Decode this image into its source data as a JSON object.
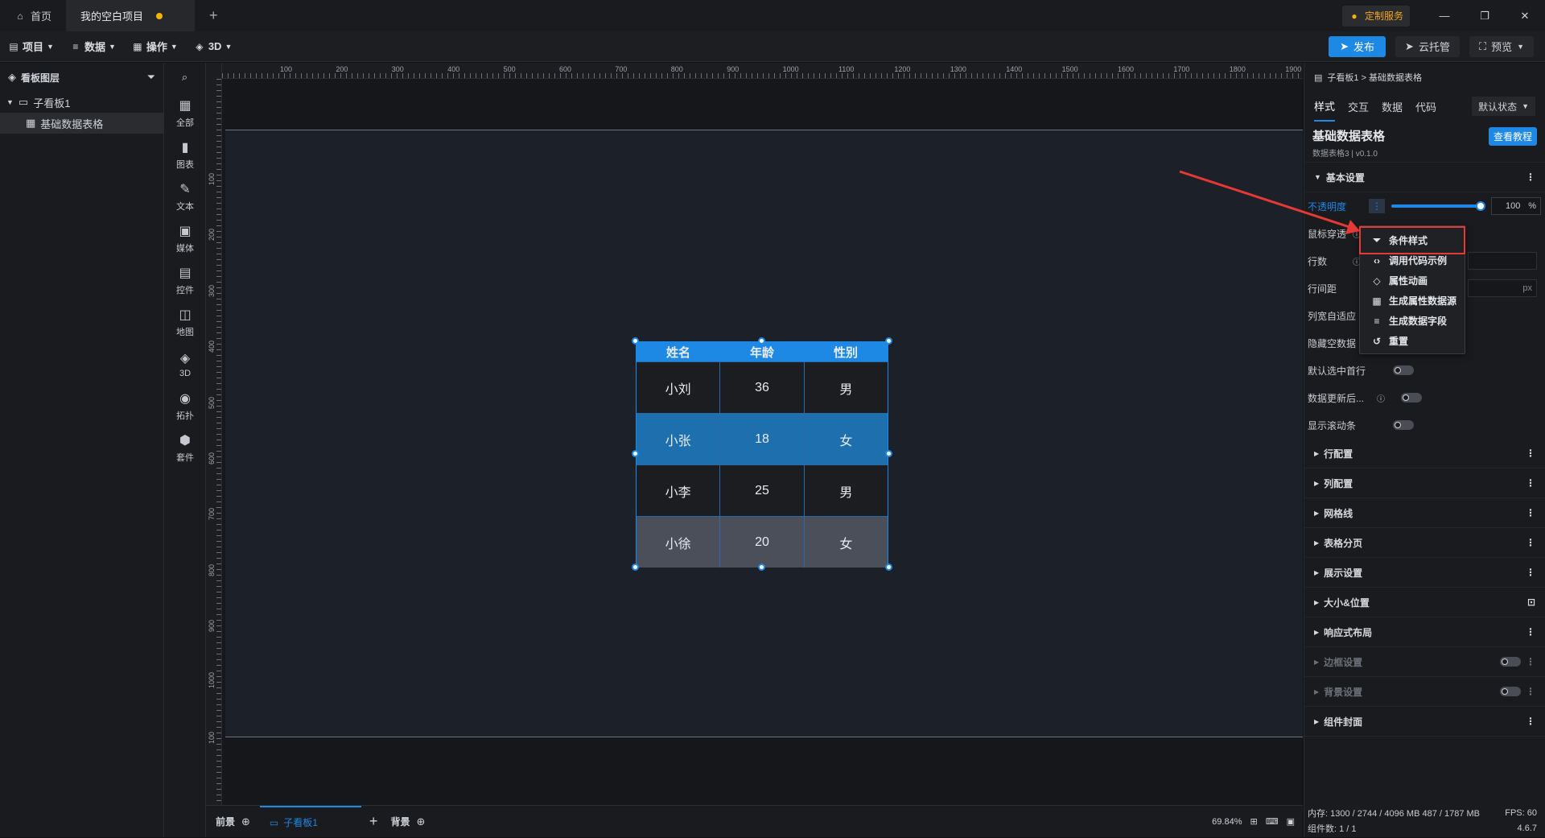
{
  "tabs": [
    {
      "label": "首页"
    },
    {
      "label": "我的空白项目"
    }
  ],
  "titlebar": {
    "custom_service": "定制服务"
  },
  "menubar": {
    "items": [
      "项目",
      "数据",
      "操作",
      "3D"
    ],
    "publish": "发布",
    "cloud": "云托管",
    "preview": "预览"
  },
  "layers": {
    "title": "看板图层",
    "tree": [
      {
        "label": "子看板1"
      },
      {
        "label": "基础数据表格"
      }
    ]
  },
  "tools": [
    "全部",
    "图表",
    "文本",
    "媒体",
    "控件",
    "地图",
    "3D",
    "拓扑",
    "套件"
  ],
  "ruler": {
    "top": [
      "100",
      "200",
      "300",
      "400",
      "500",
      "600",
      "700",
      "800",
      "900",
      "1000",
      "1100",
      "1200",
      "1300",
      "1400",
      "1500",
      "1600",
      "1700",
      "1800",
      "1900"
    ],
    "left": [
      "100",
      "200",
      "300",
      "400",
      "500",
      "600",
      "700",
      "800",
      "900",
      "1000",
      "100"
    ]
  },
  "table": {
    "headers": [
      "姓名",
      "年龄",
      "性别"
    ],
    "rows": [
      [
        "小刘",
        "36",
        "男"
      ],
      [
        "小张",
        "18",
        "女"
      ],
      [
        "小李",
        "25",
        "男"
      ],
      [
        "小徐",
        "20",
        "女"
      ]
    ],
    "row_colors": [
      "#1b1d21",
      "#1e6fae",
      "#1b1d21",
      "#4a4f5a"
    ]
  },
  "right": {
    "breadcrumb": "子看板1 > 基础数据表格",
    "tabs": [
      "样式",
      "交互",
      "数据",
      "代码"
    ],
    "state": "默认状态",
    "comp_title": "基础数据表格",
    "comp_version": "数据表格3 | v0.1.0",
    "tutorial": "查看教程",
    "basic": "基本设置",
    "props": [
      {
        "label": "不透明度"
      },
      {
        "label": "鼠标穿透"
      },
      {
        "label": "行数"
      },
      {
        "label": "行间距"
      },
      {
        "label": "列宽自适应"
      },
      {
        "label": "隐藏空数据"
      },
      {
        "label": "默认选中首行"
      },
      {
        "label": "数据更新后..."
      },
      {
        "label": "显示滚动条"
      }
    ],
    "opacity_value": "100",
    "opacity_unit": "%",
    "px": "px",
    "sections": [
      "行配置",
      "列配置",
      "网格线",
      "表格分页",
      "展示设置",
      "大小&位置",
      "响应式布局",
      "边框设置",
      "背景设置",
      "组件封面"
    ]
  },
  "ctx": [
    "条件样式",
    "调用代码示例",
    "属性动画",
    "生成属性数据源",
    "生成数据字段",
    "重置"
  ],
  "bottom": {
    "front": "前景",
    "board": "子看板1",
    "back": "背景",
    "zoom": "69.84%"
  },
  "status": {
    "memory": "内存: 1300 / 2744 / 4096 MB  487 / 1787 MB",
    "fps": "FPS: 60",
    "count": "组件数: 1 / 1",
    "version": "4.6.7"
  },
  "colors": {
    "accent": "#1e88e5",
    "highlight_box": "#e53935",
    "arrow": "#e53935"
  }
}
